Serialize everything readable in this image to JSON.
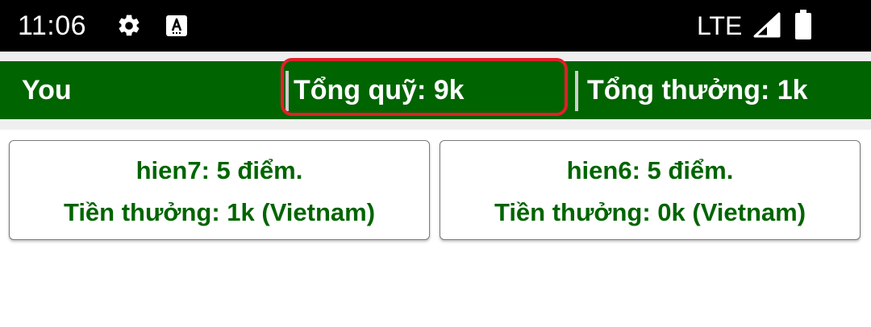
{
  "status_bar": {
    "time": "11:06",
    "network": "LTE",
    "icons": [
      "gear-icon",
      "font-a-icon",
      "signal-icon",
      "battery-icon"
    ]
  },
  "header": {
    "player": "You",
    "fund": "Tổng quỹ: 9k",
    "prize": "Tổng thưởng: 1k",
    "highlight_color": "#e0202a",
    "background_color": "#006400"
  },
  "players": [
    {
      "score_line": "hien7: 5 điểm.",
      "reward_line": "Tiền thưởng: 1k (Vietnam)"
    },
    {
      "score_line": "hien6: 5 điểm.",
      "reward_line": "Tiền thưởng: 0k (Vietnam)"
    }
  ],
  "colors": {
    "accent_green": "#006400",
    "highlight_red": "#e0202a"
  }
}
